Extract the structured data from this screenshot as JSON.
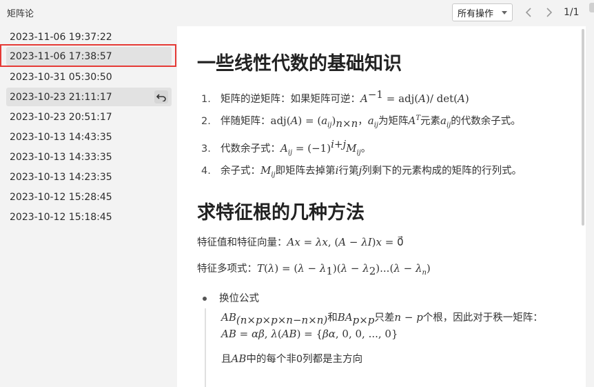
{
  "window": {
    "title": "矩阵论",
    "actions_dropdown": "所有操作",
    "page_counter": "1/1"
  },
  "icons": {
    "prev": "chevron-left-icon",
    "next": "chevron-right-icon",
    "restore": "restore-undo-icon",
    "caret": "chevron-down-icon"
  },
  "colors": {
    "selection_outline": "#e53935",
    "item_highlight": "#e2e2e2",
    "sidebar_bg": "#f3f3f3",
    "content_bg": "#ffffff"
  },
  "versions": [
    {
      "label": "2023-11-06 19:37:22"
    },
    {
      "label": "2023-11-06 17:38:57",
      "selected": true
    },
    {
      "label": "2023-10-31 05:30:50"
    },
    {
      "label": "2023-10-23 21:11:17",
      "hovered": true
    },
    {
      "label": "2023-10-23 20:51:17"
    },
    {
      "label": "2023-10-13 14:43:35"
    },
    {
      "label": "2023-10-13 14:33:35"
    },
    {
      "label": "2023-10-13 14:23:35"
    },
    {
      "label": "2023-10-12 15:28:45"
    },
    {
      "label": "2023-10-12 15:18:45"
    }
  ],
  "document": {
    "heading1": "一些线性代数的基础知识",
    "list": [
      {
        "num": "1.",
        "text": "矩阵的逆矩阵：如果矩阵可逆："
      },
      {
        "num": "2.",
        "text": "伴随矩阵："
      },
      {
        "num": "3.",
        "text": "代数余子式："
      },
      {
        "num": "4.",
        "text": "余子式："
      }
    ],
    "list_tail": {
      "item2_mid": "为矩阵",
      "item2_mid2": "元素",
      "item2_end": "的代数余子式。",
      "item3_end": "。",
      "item4_a": "即矩阵去掉第",
      "item4_b": "行第",
      "item4_c": "列剩下的元素构成的矩阵的行列式。"
    },
    "heading2": "求特征根的几种方法",
    "para1": "特征值和特征向量：",
    "para2": "特征多项式：",
    "bullet": "换位公式",
    "quote": {
      "a1": "和",
      "a2": "只差",
      "a3": "个根，因此对于秩一矩阵：",
      "b": "且",
      "b2": "中的每个非0列都是主方向"
    }
  }
}
